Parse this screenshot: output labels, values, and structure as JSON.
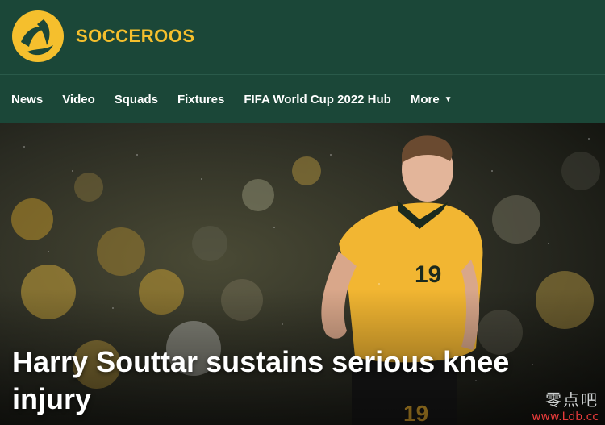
{
  "brand": {
    "name": "SOCCEROOS",
    "logo_icon": "socceroos-logo-icon",
    "color": "#f5bf2d"
  },
  "nav": {
    "items": [
      {
        "label": "News"
      },
      {
        "label": "Video"
      },
      {
        "label": "Squads"
      },
      {
        "label": "Fixtures"
      },
      {
        "label": "FIFA World Cup 2022 Hub"
      },
      {
        "label": "More"
      }
    ],
    "more_icon": "caret-down-icon"
  },
  "hero": {
    "headline": "Harry Souttar sustains serious knee injury",
    "jersey_number": "19",
    "image_icon": "player-photo"
  },
  "watermark": {
    "chinese": "零点吧",
    "url": "www.Ldb.cc"
  },
  "colors": {
    "header_bg": "#1b4738",
    "accent": "#f5bf2d",
    "jersey": "#f2b632"
  }
}
